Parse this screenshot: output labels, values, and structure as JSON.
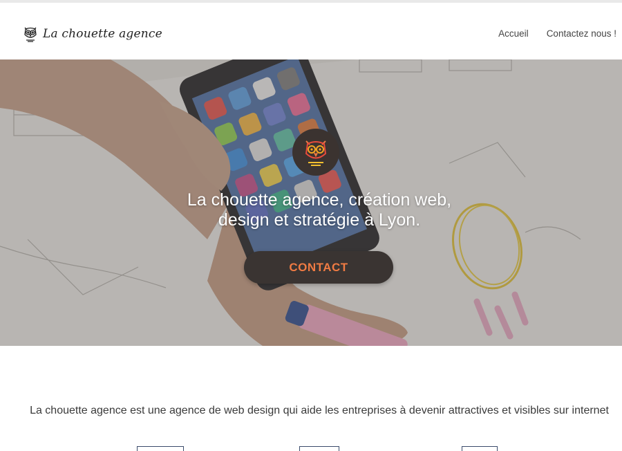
{
  "header": {
    "brand": "La chouette agence",
    "nav": [
      {
        "label": "Accueil"
      },
      {
        "label": "Contactez nous !"
      }
    ]
  },
  "hero": {
    "title_line1": "La chouette agence, création web,",
    "title_line2": "design et stratégie à Lyon.",
    "cta_label": "CONTACT",
    "badge_icon": "owl-icon"
  },
  "intro": {
    "text": "La chouette agence est une agence de web design qui aide les entreprises à devenir attractives et visibles sur internet"
  },
  "colors": {
    "accent": "#f07b43",
    "button_bg": "#3a3432",
    "badge_bg": "#3b3330"
  }
}
